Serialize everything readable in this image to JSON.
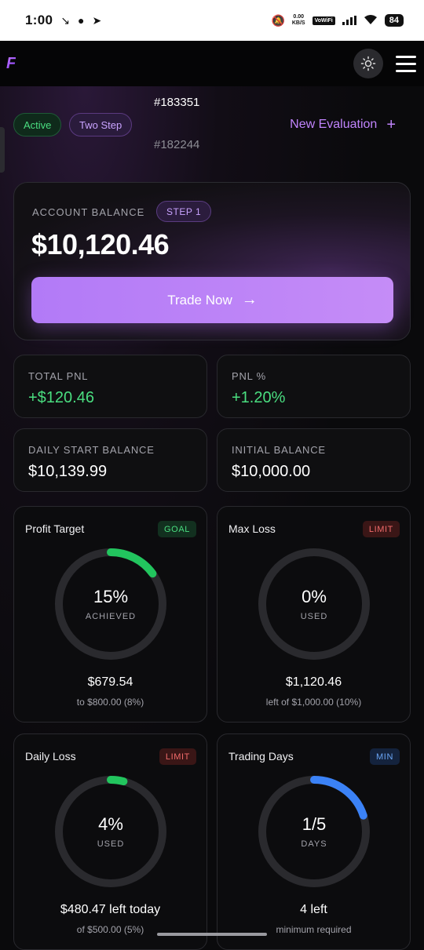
{
  "status_bar": {
    "time": "1:00",
    "net_speed_top": "0.00",
    "net_speed_bottom": "KB/S",
    "vowifi": "VoWiFi",
    "battery": "84"
  },
  "header": {
    "logo_letter": "F",
    "theme_icon": "sun-icon",
    "menu_icon": "hamburger-icon"
  },
  "account_bar": {
    "status_badge": "Active",
    "type_badge": "Two Step",
    "accounts": [
      "#183351",
      "#182244"
    ],
    "new_evaluation_label": "New Evaluation",
    "new_evaluation_icon": "+"
  },
  "balance": {
    "label": "ACCOUNT BALANCE",
    "step_badge": "STEP 1",
    "value": "$10,120.46",
    "trade_button_label": "Trade Now",
    "trade_button_icon": "→"
  },
  "stats": [
    {
      "label": "TOTAL PNL",
      "value": "+$120.46",
      "positive": true
    },
    {
      "label": "PNL %",
      "value": "+1.20%",
      "positive": true
    },
    {
      "label": "DAILY START BALANCE",
      "value": "$10,139.99",
      "positive": false
    },
    {
      "label": "INITIAL BALANCE",
      "value": "$10,000.00",
      "positive": false
    }
  ],
  "metrics": [
    {
      "title": "Profit Target",
      "tag": "GOAL",
      "percent_text": "15%",
      "sub_label": "ACHIEVED",
      "progress": 0.15,
      "arc_color": "#22c55e",
      "main_text": "$679.54",
      "sub_text": "to $800.00 (8%)"
    },
    {
      "title": "Max Loss",
      "tag": "LIMIT",
      "percent_text": "0%",
      "sub_label": "USED",
      "progress": 0,
      "arc_color": "#ef4444",
      "main_text": "$1,120.46",
      "sub_text": "left of $1,000.00 (10%)"
    },
    {
      "title": "Daily Loss",
      "tag": "LIMIT",
      "percent_text": "4%",
      "sub_label": "USED",
      "progress": 0.04,
      "arc_color": "#22c55e",
      "main_text": "$480.47 left today",
      "sub_text": "of $500.00 (5%)"
    },
    {
      "title": "Trading Days",
      "tag": "MIN",
      "percent_text": "1/5",
      "sub_label": "DAYS",
      "progress": 0.2,
      "arc_color": "#3b82f6",
      "main_text": "4 left",
      "sub_text": "minimum required"
    }
  ],
  "colors": {
    "accent_purple": "#c084fc",
    "positive_green": "#4ade80",
    "limit_red": "#f26b6b",
    "min_blue": "#6aa5f5"
  }
}
